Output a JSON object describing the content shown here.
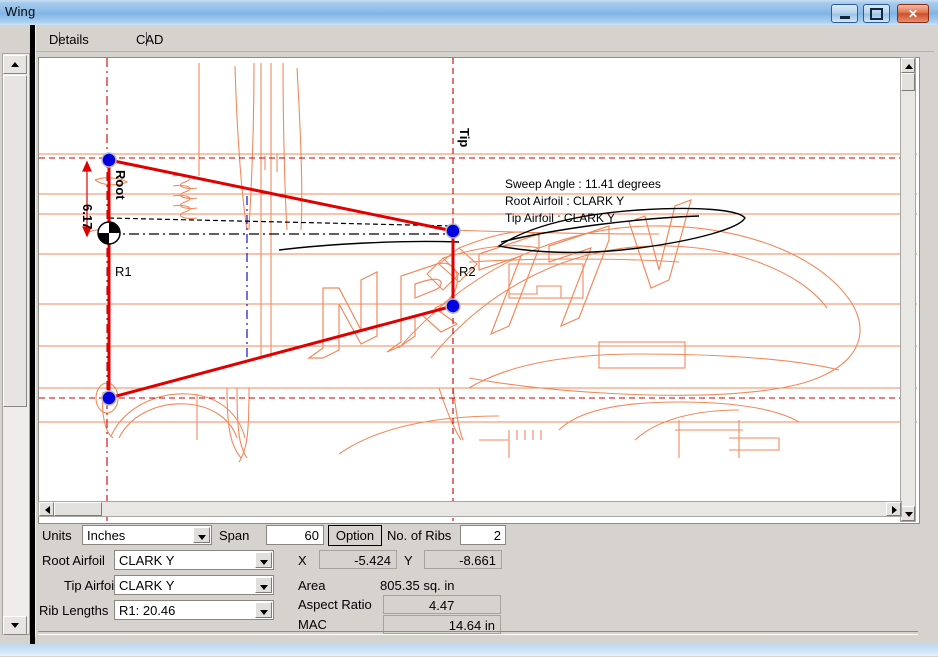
{
  "window": {
    "title": "Wing",
    "controls": {
      "minimize": "minimize",
      "maximize": "maximize",
      "close": "✕"
    }
  },
  "tabs": [
    {
      "id": "details",
      "label": "Details",
      "active": true
    },
    {
      "id": "cad",
      "label": "CAD",
      "active": false
    }
  ],
  "drawing": {
    "annotations": {
      "sweep_angle": "Sweep Angle : 11.41 degrees",
      "root_airfoil": "Root Airfoil : CLARK Y",
      "tip_airfoil": "Tip Airfoil  : CLARK Y"
    },
    "labels": {
      "root_station": "Root",
      "tip_station": "Tip",
      "rib1": "R1",
      "rib2": "R2",
      "dimension": "6.17"
    },
    "blueprint_registration": "NR77V",
    "colors": {
      "blueprint": "#f08a5d",
      "wing_outline": "#e00000",
      "node": "#0000e0",
      "construction": "#d00000",
      "airfoil": "#000000",
      "centerline_blue": "#0000c0"
    }
  },
  "form": {
    "units_label": "Units",
    "units_value": "Inches",
    "span_label": "Span",
    "span_value": "60",
    "option_button": "Option",
    "ribs_label": "No. of Ribs",
    "ribs_value": "2",
    "root_airfoil_label": "Root Airfoil",
    "root_airfoil_value": "CLARK Y",
    "tip_airfoil_label": "Tip Airfoil",
    "tip_airfoil_value": "CLARK Y",
    "rib_lengths_label": "Rib Lengths",
    "rib_lengths_value": "R1: 20.46",
    "x_label": "X",
    "x_value": "-5.424",
    "y_label": "Y",
    "y_value": "-8.661",
    "area_label": "Area",
    "area_value": "805.35 sq. in",
    "aspect_ratio_label": "Aspect Ratio",
    "aspect_ratio_value": "4.47",
    "mac_label": "MAC",
    "mac_value": "14.64 in"
  }
}
